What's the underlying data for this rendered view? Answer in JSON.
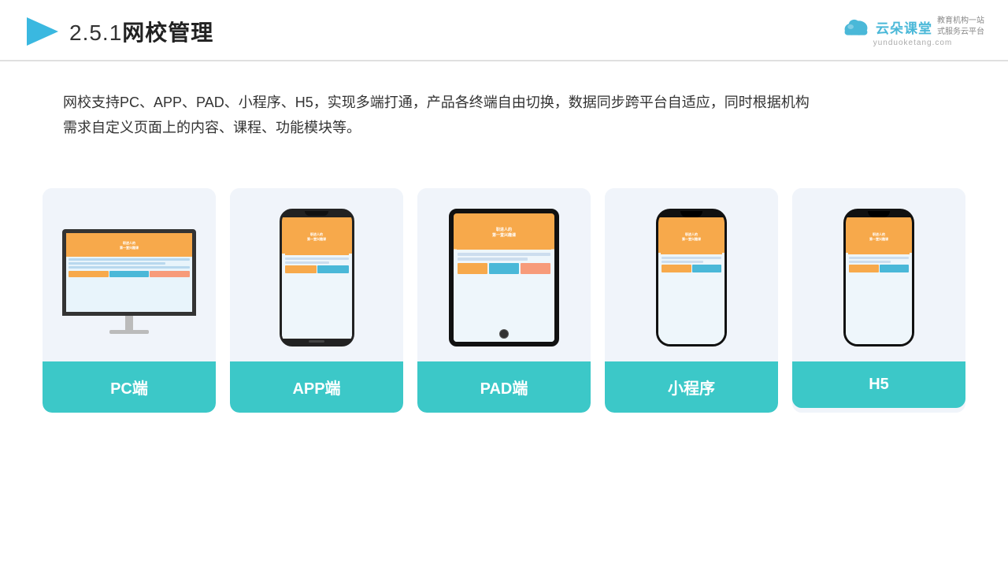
{
  "header": {
    "title": "2.5.1网校管理",
    "logo": {
      "text_cn": "云朵课堂",
      "url": "yunduoketang.com",
      "tagline": "教育机构一站\n式服务云平台"
    }
  },
  "description": {
    "text": "网校支持PC、APP、PAD、小程序、H5，实现多端打通，产品各终端自由切换，数据同步跨平台自适应，同时根据机构需求自定义页面上的内容、课程、功能模块等。"
  },
  "cards": [
    {
      "id": "pc",
      "label": "PC端"
    },
    {
      "id": "app",
      "label": "APP端"
    },
    {
      "id": "pad",
      "label": "PAD端"
    },
    {
      "id": "mini",
      "label": "小程序"
    },
    {
      "id": "h5",
      "label": "H5"
    }
  ],
  "colors": {
    "teal": "#3cc8c8",
    "accent_orange": "#f7a94b",
    "bg_card": "#f0f4fa",
    "text_dark": "#333"
  }
}
